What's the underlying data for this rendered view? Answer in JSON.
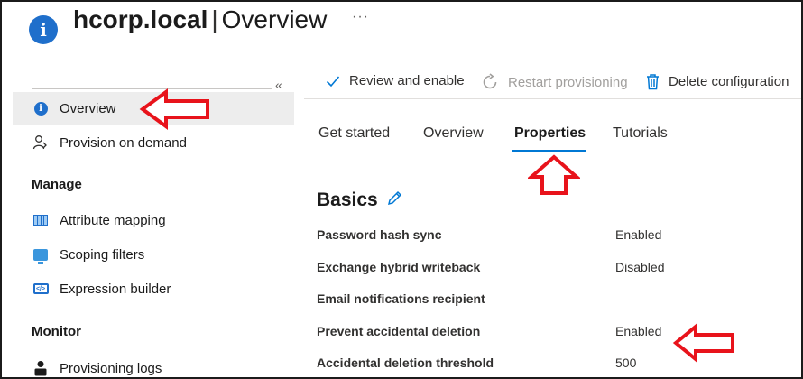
{
  "header": {
    "site": "hcorp.local",
    "separator": "|",
    "page": "Overview",
    "more": "···"
  },
  "sidebar": {
    "collapse_glyph": "«",
    "items": [
      {
        "label": "Overview",
        "icon": "info-icon",
        "selected": true
      },
      {
        "label": "Provision on demand",
        "icon": "provision-on-demand-icon"
      }
    ],
    "sections": [
      {
        "title": "Manage",
        "items": [
          {
            "label": "Attribute mapping",
            "icon": "attribute-mapping-icon"
          },
          {
            "label": "Scoping filters",
            "icon": "scoping-filters-icon"
          },
          {
            "label": "Expression builder",
            "icon": "expression-builder-icon"
          }
        ]
      },
      {
        "title": "Monitor",
        "items": [
          {
            "label": "Provisioning logs",
            "icon": "provisioning-logs-icon"
          }
        ]
      }
    ]
  },
  "toolbar": {
    "review_label": "Review and enable",
    "restart_label": "Restart provisioning",
    "delete_label": "Delete configuration"
  },
  "tabs": [
    {
      "label": "Get started"
    },
    {
      "label": "Overview"
    },
    {
      "label": "Properties",
      "selected": true
    },
    {
      "label": "Tutorials"
    }
  ],
  "basics": {
    "title": "Basics",
    "properties": [
      {
        "key": "Password hash sync",
        "value": "Enabled"
      },
      {
        "key": "Exchange hybrid writeback",
        "value": "Disabled"
      },
      {
        "key": "Email notifications recipient",
        "value": ""
      },
      {
        "key": "Prevent accidental deletion",
        "value": "Enabled"
      },
      {
        "key": "Accidental deletion threshold",
        "value": "500"
      }
    ]
  },
  "colors": {
    "accent": "#0078d4",
    "annotation_arrow": "#e8131b",
    "selected_nav_bg": "#ededed"
  }
}
